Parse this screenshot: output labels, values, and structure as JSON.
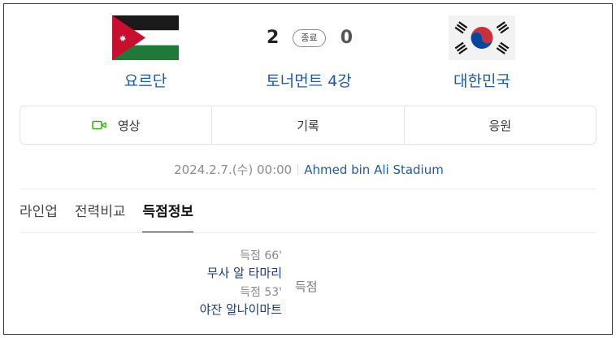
{
  "match": {
    "home_team": "요르단",
    "away_team": "대한민국",
    "home_score": "2",
    "away_score": "0",
    "status": "종료",
    "round": "토너먼트 4강",
    "home_flag_icon": "jordan-flag-icon",
    "away_flag_icon": "korea-flag-icon"
  },
  "actions": {
    "video_label": "영상",
    "video_icon": "video-camera-icon",
    "record_label": "기록",
    "cheer_label": "응원"
  },
  "meta": {
    "date": "2024.2.7.(수) 00:00",
    "venue": "Ahmed bin Ali Stadium"
  },
  "subtabs": [
    "라인업",
    "전력비교",
    "득점정보"
  ],
  "goals": {
    "label": "득점",
    "items": [
      {
        "time": "득점 66'",
        "player": "무사 알 타마리"
      },
      {
        "time": "득점 53'",
        "player": "야잔 알나이마트"
      }
    ]
  },
  "colors": {
    "link_blue": "#1f5aa8",
    "video_green": "#2db400"
  }
}
